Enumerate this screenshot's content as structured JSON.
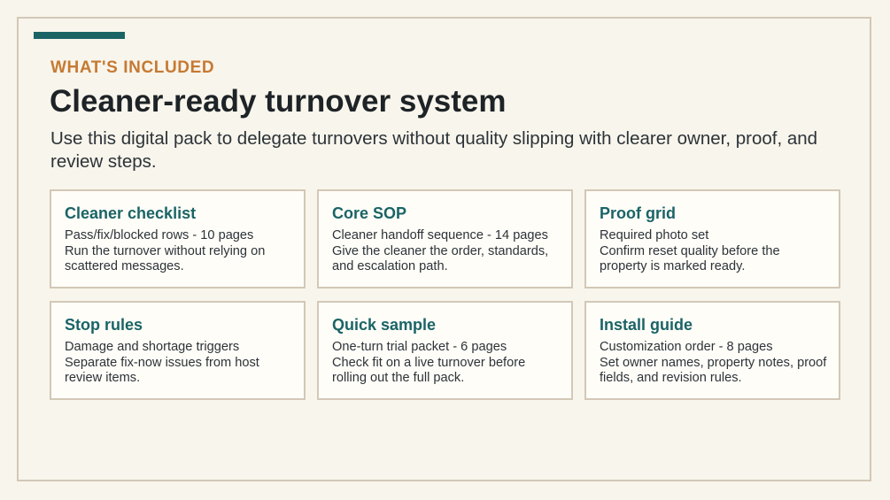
{
  "theme": {
    "accent": "#1a6466",
    "eyebrow": "#c67a33",
    "heading": "#1d2326",
    "text": "#2c3338"
  },
  "header": {
    "eyebrow": "WHAT'S INCLUDED",
    "title": "Cleaner-ready turnover system",
    "lead": "Use this digital pack to delegate turnovers without quality slipping with clearer owner, proof, and review steps."
  },
  "cards": [
    {
      "title": "Cleaner checklist",
      "meta": "Pass/fix/blocked rows - 10 pages",
      "desc": "Run the turnover without relying on scattered messages."
    },
    {
      "title": "Core SOP",
      "meta": "Cleaner handoff sequence - 14 pages",
      "desc": "Give the cleaner the order, standards, and escalation path."
    },
    {
      "title": "Proof grid",
      "meta": "Required photo set",
      "desc": "Confirm reset quality before the property is marked ready."
    },
    {
      "title": "Stop rules",
      "meta": "Damage and shortage triggers",
      "desc": "Separate fix-now issues from host review items."
    },
    {
      "title": "Quick sample",
      "meta": "One-turn trial packet - 6 pages",
      "desc": "Check fit on a live turnover before rolling out the full pack."
    },
    {
      "title": "Install guide",
      "meta": "Customization order - 8 pages",
      "desc": "Set owner names, property notes, proof fields, and revision rules."
    }
  ]
}
